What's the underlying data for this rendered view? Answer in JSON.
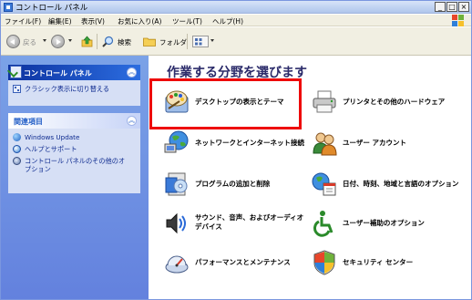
{
  "window": {
    "title": "コントロール パネル",
    "buttons": {
      "minimize": "_",
      "maximize": "□",
      "close": "×"
    }
  },
  "menu": [
    {
      "label": "ファイル(F)"
    },
    {
      "label": "編集(E)"
    },
    {
      "label": "表示(V)"
    },
    {
      "label": "お気に入り(A)"
    },
    {
      "label": "ツール(T)"
    },
    {
      "label": "ヘルプ(H)"
    }
  ],
  "toolbar": {
    "back_label": "戻る",
    "search_label": "検索",
    "folders_label": "フォルダ"
  },
  "sidebar": {
    "panel_title": "コントロール パネル",
    "panel_link": "クラシック表示に切り替える",
    "related_title": "関連項目",
    "related_links": [
      {
        "label": "Windows Update"
      },
      {
        "label": "ヘルプとサポート"
      },
      {
        "label_line1": "コントロール パネルのその他のオ",
        "label_line2": "プション"
      }
    ]
  },
  "main": {
    "heading": "作業する分野を選びます",
    "categories": [
      {
        "label": "デスクトップの表示とテーマ",
        "icon": "desktop-theme-icon"
      },
      {
        "label": "プリンタとその他のハードウェア",
        "icon": "printer-icon"
      },
      {
        "label": "ネットワークとインターネット接続",
        "icon": "network-globe-icon"
      },
      {
        "label": "ユーザー アカウント",
        "icon": "user-accounts-icon"
      },
      {
        "label": "プログラムの追加と削除",
        "icon": "add-remove-programs-icon"
      },
      {
        "label": "日付、時刻、地域と言語のオプション",
        "icon": "date-time-globe-icon"
      },
      {
        "label_line1": "サウンド、音声、およびオーディオ",
        "label_line2": "デバイス",
        "icon": "sound-speech-icon"
      },
      {
        "label": "ユーザー補助のオプション",
        "icon": "accessibility-icon"
      },
      {
        "label": "パフォーマンスとメンテナンス",
        "icon": "performance-icon"
      },
      {
        "label": "セキュリティ センター",
        "icon": "security-shield-icon"
      }
    ]
  },
  "colors": {
    "highlight_border": "#ee0a0a",
    "sidebar_gradient_top": "#7ba2e7",
    "panel_header": "#0c32a0",
    "link_text": "#0d2a8f"
  }
}
